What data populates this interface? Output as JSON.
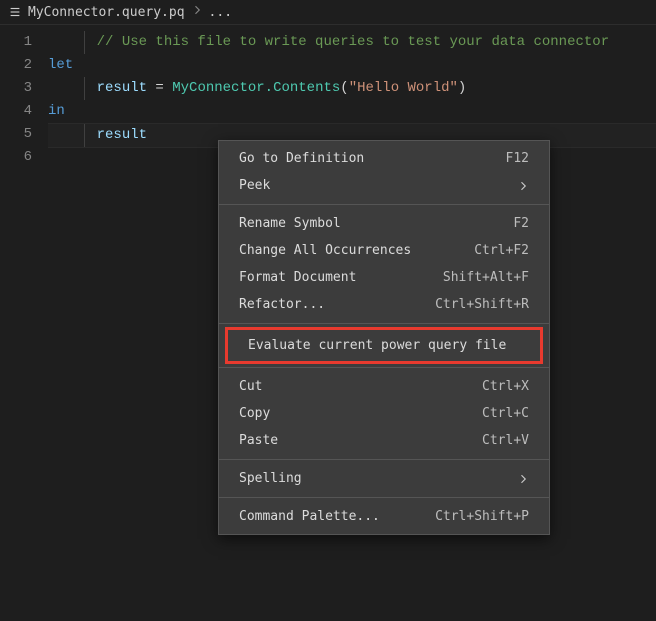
{
  "breadcrumb": {
    "filename": "MyConnector.query.pq",
    "more": "..."
  },
  "code": {
    "lines": [
      {
        "n": "1",
        "segments": [
          {
            "cls": "tok-comment",
            "text": "// Use this file to write queries to test your data connector"
          }
        ],
        "indent": 1
      },
      {
        "n": "2",
        "segments": [
          {
            "cls": "tok-keyword",
            "text": "let"
          }
        ],
        "indent": 0
      },
      {
        "n": "3",
        "segments": [
          {
            "cls": "tok-ident",
            "text": "result"
          },
          {
            "cls": "tok-plain",
            "text": " = "
          },
          {
            "cls": "tok-func",
            "text": "MyConnector.Contents"
          },
          {
            "cls": "tok-plain",
            "text": "("
          },
          {
            "cls": "tok-string",
            "text": "\"Hello World\""
          },
          {
            "cls": "tok-plain",
            "text": ")"
          }
        ],
        "indent": 1
      },
      {
        "n": "4",
        "segments": [
          {
            "cls": "tok-keyword",
            "text": "in"
          }
        ],
        "indent": 0
      },
      {
        "n": "5",
        "segments": [
          {
            "cls": "tok-ident",
            "text": "result"
          }
        ],
        "indent": 1,
        "current": true
      },
      {
        "n": "6",
        "segments": [],
        "indent": 0
      }
    ]
  },
  "menu": {
    "groups": [
      [
        {
          "label": "Go to Definition",
          "shortcut": "F12"
        },
        {
          "label": "Peek",
          "submenu": true
        }
      ],
      [
        {
          "label": "Rename Symbol",
          "shortcut": "F2"
        },
        {
          "label": "Change All Occurrences",
          "shortcut": "Ctrl+F2"
        },
        {
          "label": "Format Document",
          "shortcut": "Shift+Alt+F"
        },
        {
          "label": "Refactor...",
          "shortcut": "Ctrl+Shift+R"
        }
      ],
      [
        {
          "label": "Evaluate current power query file",
          "highlighted": true
        }
      ],
      [
        {
          "label": "Cut",
          "shortcut": "Ctrl+X"
        },
        {
          "label": "Copy",
          "shortcut": "Ctrl+C"
        },
        {
          "label": "Paste",
          "shortcut": "Ctrl+V"
        }
      ],
      [
        {
          "label": "Spelling",
          "submenu": true
        }
      ],
      [
        {
          "label": "Command Palette...",
          "shortcut": "Ctrl+Shift+P"
        }
      ]
    ]
  }
}
